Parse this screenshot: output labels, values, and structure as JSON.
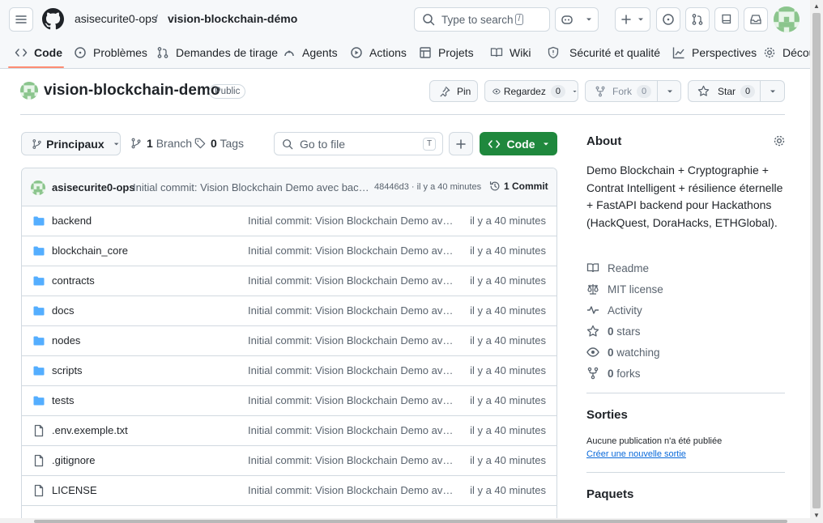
{
  "header": {
    "owner": "asisecurite0-ops",
    "separator": "/",
    "repo": "vision-blockchain-démo",
    "search_placeholder": "Type to search",
    "search_key": "/"
  },
  "tabs": [
    {
      "label": "Code"
    },
    {
      "label": "Problèmes"
    },
    {
      "label": "Demandes de tirage"
    },
    {
      "label": "Agents"
    },
    {
      "label": "Actions"
    },
    {
      "label": "Projets"
    },
    {
      "label": "Wiki"
    },
    {
      "label": "Sécurité et qualité"
    },
    {
      "label": "Perspectives"
    },
    {
      "label": "Décou"
    }
  ],
  "repo": {
    "name": "vision-blockchain-demo",
    "visibility": "Public",
    "pin_label": "Pin",
    "watch_label": "Regardez",
    "watch_count": "0",
    "fork_label": "Fork",
    "fork_count": "0",
    "star_label": "Star",
    "star_count": "0"
  },
  "branch_bar": {
    "branch_label": "Principaux",
    "branch_count": "1",
    "branch_word": "Branch",
    "tag_count": "0",
    "tag_word": "Tags",
    "gofile_placeholder": "Go to file",
    "gofile_key": "T",
    "code_label": "Code"
  },
  "commit": {
    "author": "asisecurite0-ops",
    "message": "Initial commit: Vision Blockchain Demo avec backend",
    "hash": "48446d3",
    "time": "· il y a 40 minutes",
    "count_label": "1 Commit"
  },
  "files": [
    {
      "type": "dir",
      "name": "backend",
      "message": "Initial commit: Vision Blockchain Demo avec ...",
      "time": "il y a 40 minutes"
    },
    {
      "type": "dir",
      "name": "blockchain_core",
      "message": "Initial commit: Vision Blockchain Demo avec ...",
      "time": "il y a 40 minutes"
    },
    {
      "type": "dir",
      "name": "contracts",
      "message": "Initial commit: Vision Blockchain Demo avec ...",
      "time": "il y a 40 minutes"
    },
    {
      "type": "dir",
      "name": "docs",
      "message": "Initial commit: Vision Blockchain Demo avec ...",
      "time": "il y a 40 minutes"
    },
    {
      "type": "dir",
      "name": "nodes",
      "message": "Initial commit: Vision Blockchain Demo avec ...",
      "time": "il y a 40 minutes"
    },
    {
      "type": "dir",
      "name": "scripts",
      "message": "Initial commit: Vision Blockchain Demo avec ...",
      "time": "il y a 40 minutes"
    },
    {
      "type": "dir",
      "name": "tests",
      "message": "Initial commit: Vision Blockchain Demo avec ...",
      "time": "il y a 40 minutes"
    },
    {
      "type": "file",
      "name": ".env.exemple.txt",
      "message": "Initial commit: Vision Blockchain Demo avec ...",
      "time": "il y a 40 minutes"
    },
    {
      "type": "file",
      "name": ".gitignore",
      "message": "Initial commit: Vision Blockchain Demo avec ...",
      "time": "il y a 40 minutes"
    },
    {
      "type": "file",
      "name": "LICENSE",
      "message": "Initial commit: Vision Blockchain Demo avec ...",
      "time": "il y a 40 minutes"
    }
  ],
  "about": {
    "title": "About",
    "description": "Demo Blockchain + Cryptographie + Contrat Intelligent + résilience éternelle + FastAPI backend pour Hackathons (HackQuest, DoraHacks, ETHGlobal).",
    "readme": "Readme",
    "license": "MIT license",
    "activity": "Activity",
    "stars_count": "0",
    "stars_word": "stars",
    "watching_count": "0",
    "watching_word": "watching",
    "forks_count": "0",
    "forks_word": "forks"
  },
  "releases": {
    "title": "Sorties",
    "none": "Aucune publication n'a été publiée",
    "create": "Créer une nouvelle sortie"
  },
  "packages": {
    "title": "Paquets"
  },
  "colors": {
    "accent_green": "#1f883d",
    "link_blue": "#0969da",
    "folder_blue": "#54aeff",
    "tab_underline": "#fd8c73"
  }
}
